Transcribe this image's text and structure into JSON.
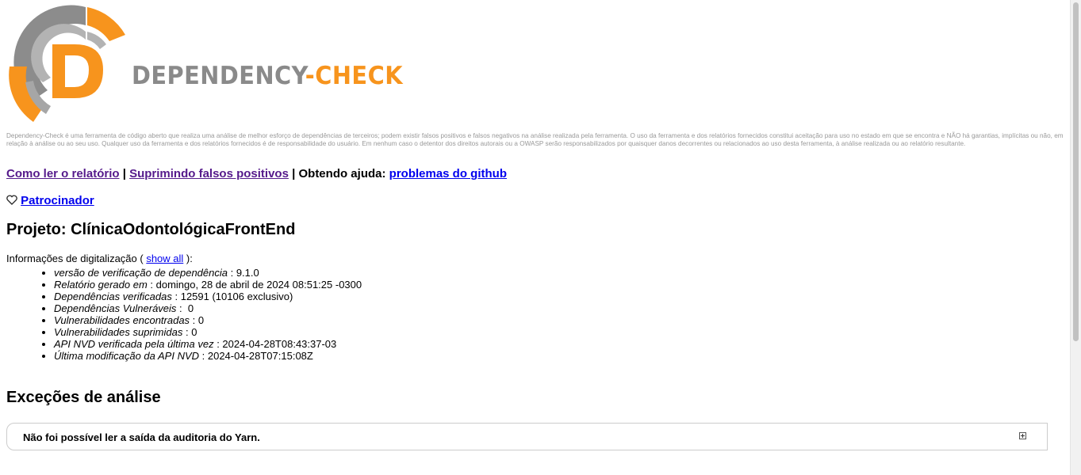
{
  "header": {
    "logo_text_part1": "DEPENDENCY",
    "logo_text_part2": "-CHECK",
    "logo_letter": "D"
  },
  "disclaimer": "Dependency-Check é uma ferramenta de código aberto que realiza uma análise de melhor esforço de dependências de terceiros; podem existir falsos positivos e falsos negativos na análise realizada pela ferramenta. O uso da ferramenta e dos relatórios fornecidos constitui aceitação para uso no estado em que se encontra e NÃO há garantias, implícitas ou não, em relação à análise ou ao seu uso. Qualquer uso da ferramenta e dos relatórios fornecidos é de responsabilidade do usuário. Em nenhum caso o detentor dos direitos autorais ou a OWASP serão responsabilizados por quaisquer danos decorrentes ou relacionados ao uso desta ferramenta, à análise realizada ou ao relatório resultante.",
  "nav": {
    "how_to_read": "Como ler o relatório",
    "separator": "|",
    "suppressing": "Suprimindo falsos positivos",
    "getting_help": "Obtendo ajuda:",
    "github_issues": "problemas do github"
  },
  "sponsor": {
    "icon": "heart-icon",
    "label": "Patrocinador"
  },
  "project": {
    "title": "Projeto: ClínicaOdontológicaFrontEnd"
  },
  "scan_info": {
    "label_before": "Informações de digitalização (",
    "show_all": "show all",
    "label_after": "):",
    "items": [
      {
        "label": "versão de verificação de dependência",
        "value": " : 9.1.0"
      },
      {
        "label": "Relatório gerado em",
        "value": " : domingo, 28 de abril de 2024 08:51:25 -0300"
      },
      {
        "label": "Dependências verificadas",
        "value": " : 12591 (10106 exclusivo)"
      },
      {
        "label": "Dependências Vulneráveis",
        "value": " :  0"
      },
      {
        "label": "Vulnerabilidades encontradas",
        "value": " : 0"
      },
      {
        "label": "Vulnerabilidades suprimidas",
        "value": " : 0"
      },
      {
        "label": "API NVD verificada pela última vez",
        "value": " : 2024-04-28T08:43:37-03"
      },
      {
        "label": "Última modificação da API NVD",
        "value": " : 2024-04-28T07:15:08Z"
      }
    ]
  },
  "exceptions": {
    "heading": "Exceções de análise",
    "items": [
      {
        "title": "Não foi possível ler a saída da auditoria do Yarn."
      }
    ]
  },
  "colors": {
    "orange": "#f7941d",
    "gray_text": "#8a8a8a",
    "link_visited": "#551a8b",
    "link": "#0000ee"
  }
}
